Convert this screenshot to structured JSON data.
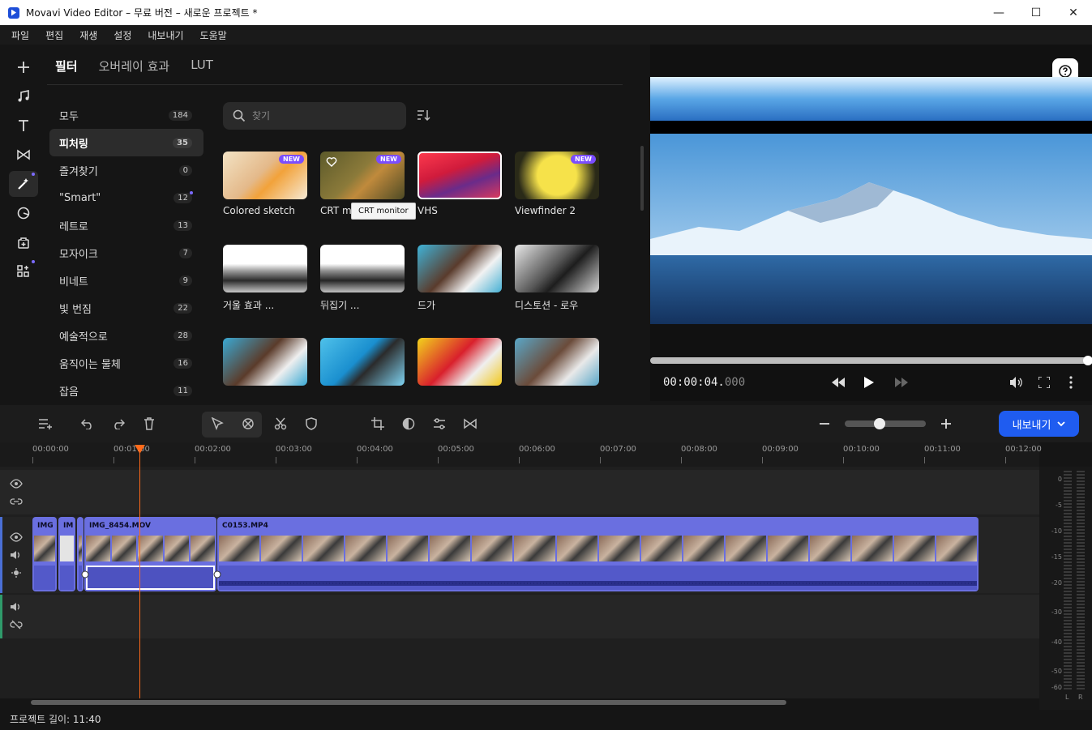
{
  "window": {
    "title": "Movavi Video Editor – 무료 버전 – 새로운 프로젝트 *",
    "controls": {
      "minimize": "—",
      "maximize": "☐",
      "close": "✕"
    }
  },
  "menu": [
    "파일",
    "편집",
    "재생",
    "설정",
    "내보내기",
    "도움말"
  ],
  "library": {
    "tabs": [
      "필터",
      "오버레이 효과",
      "LUT"
    ],
    "active_tab": "필터",
    "categories": [
      {
        "label": "모두",
        "count": "184"
      },
      {
        "label": "피처링",
        "count": "35"
      },
      {
        "label": "즐겨찾기",
        "count": "0"
      },
      {
        "label": "\"Smart\"",
        "count": "12"
      },
      {
        "label": "레트로",
        "count": "13"
      },
      {
        "label": "모자이크",
        "count": "7"
      },
      {
        "label": "비네트",
        "count": "9"
      },
      {
        "label": "빛 번짐",
        "count": "22"
      },
      {
        "label": "예술적으로",
        "count": "28"
      },
      {
        "label": "움직이는 물체",
        "count": "16"
      },
      {
        "label": "잡음",
        "count": "11"
      }
    ],
    "active_category": "피처링",
    "search_placeholder": "찾기",
    "new_badge": "NEW",
    "tooltip": "CRT monitor",
    "filters": [
      {
        "label": "Colored sketch",
        "new": true
      },
      {
        "label": "CRT mo",
        "new": true
      },
      {
        "label": "VHS",
        "new": false
      },
      {
        "label": "Viewfinder 2",
        "new": true
      },
      {
        "label": "거울 효과 ...",
        "new": false
      },
      {
        "label": "뒤집기 ...",
        "new": false
      },
      {
        "label": "드가",
        "new": false
      },
      {
        "label": "디스토션 - 로우",
        "new": false
      },
      {
        "label": "",
        "new": false
      },
      {
        "label": "",
        "new": false
      },
      {
        "label": "",
        "new": false
      },
      {
        "label": "",
        "new": false
      }
    ]
  },
  "preview": {
    "timecode_main": "00:00:04.",
    "timecode_ms": "000",
    "progress": 1.0
  },
  "toolbar": {
    "export_label": "내보내기",
    "zoom_level": 0.42
  },
  "timeline": {
    "ruler": [
      "00:00:00",
      "00:01:00",
      "00:02:00",
      "00:03:00",
      "00:04:00",
      "00:05:00",
      "00:06:00",
      "00:07:00",
      "00:08:00",
      "00:09:00",
      "00:10:00",
      "00:11:00",
      "00:12:00"
    ],
    "clips": [
      "IMG",
      "IM",
      "IMG_8454.MOV",
      "C0153.MP4"
    ],
    "vu_levels": [
      "0",
      "-5",
      "-10",
      "-15",
      "-20",
      "-30",
      "-40",
      "-50",
      "-60"
    ],
    "vu_channels": [
      "L",
      "R"
    ]
  },
  "status": {
    "project_length": "프로젝트 길이: 11:40"
  },
  "colors": {
    "accent": "#1f5cf0",
    "clip": "#6a6fe0",
    "playhead": "#ff6a1a",
    "badge": "#7b4dff"
  }
}
